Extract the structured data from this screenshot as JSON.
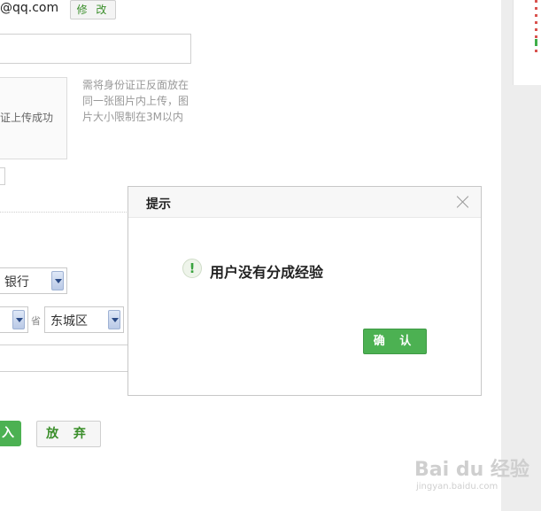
{
  "form": {
    "email_partial": "@qq.com",
    "edit_label": "修 改",
    "upload_status": "证上传成功",
    "upload_hint": "需将身份证正反面放在同一张图片内上传，图片大小限制在3M以内",
    "bank_select_value": "银行",
    "city_suffix": "省",
    "district_select_value": "东城区",
    "submit_partial": "入",
    "abandon_label": "放 弃"
  },
  "dialog": {
    "title": "提示",
    "message": "用户没有分成经验",
    "icon_glyph": "!",
    "confirm_label": "确 认"
  },
  "watermark": {
    "brand": "Bai du 经验",
    "url": "jingyan.baidu.com"
  },
  "colors": {
    "accent_green": "#4cb152",
    "link_green": "#3a8e2a"
  }
}
